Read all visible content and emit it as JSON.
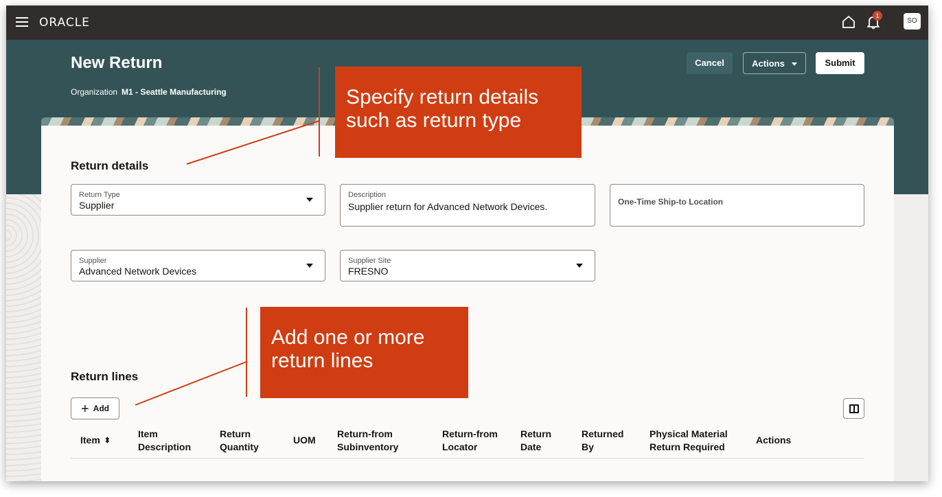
{
  "topbar": {
    "logo": "ORACLE",
    "notification_count": "1",
    "avatar_initials": "SO"
  },
  "header": {
    "title": "New Return",
    "org_label": "Organization",
    "org_value": "M1 - Seattle Manufacturing",
    "cancel_label": "Cancel",
    "actions_label": "Actions",
    "submit_label": "Submit"
  },
  "return_details": {
    "title": "Return details",
    "return_type": {
      "label": "Return Type",
      "value": "Supplier"
    },
    "description": {
      "label": "Description",
      "value": "Supplier return for Advanced Network Devices."
    },
    "ship_to": {
      "placeholder": "One-Time Ship-to Location"
    },
    "supplier": {
      "label": "Supplier",
      "value": "Advanced Network Devices"
    },
    "supplier_site": {
      "label": "Supplier Site",
      "value": "FRESNO"
    }
  },
  "return_lines": {
    "title": "Return lines",
    "add_label": "Add",
    "columns": [
      {
        "line1": "Item",
        "line2": ""
      },
      {
        "line1": "Item",
        "line2": "Description"
      },
      {
        "line1": "Return",
        "line2": "Quantity"
      },
      {
        "line1": "UOM",
        "line2": ""
      },
      {
        "line1": "Return-from",
        "line2": "Subinventory"
      },
      {
        "line1": "Return-from",
        "line2": "Locator"
      },
      {
        "line1": "Return",
        "line2": "Date"
      },
      {
        "line1": "Returned",
        "line2": "By"
      },
      {
        "line1": "Physical Material",
        "line2": "Return Required"
      },
      {
        "line1": "Actions",
        "line2": ""
      }
    ]
  },
  "callouts": {
    "details": {
      "line1": "Specify return details",
      "line2": "such as return type"
    },
    "lines": {
      "line1": "Add one or more",
      "line2": "return lines"
    }
  },
  "icons": [
    "hamburger-icon",
    "home-icon",
    "bell-icon",
    "chevron-down-icon",
    "sort-icon",
    "plus-icon",
    "columns-icon"
  ],
  "colors": {
    "topbar": "#312d2a",
    "header": "#335357",
    "callout": "#d03d12",
    "badge": "#c74634"
  }
}
